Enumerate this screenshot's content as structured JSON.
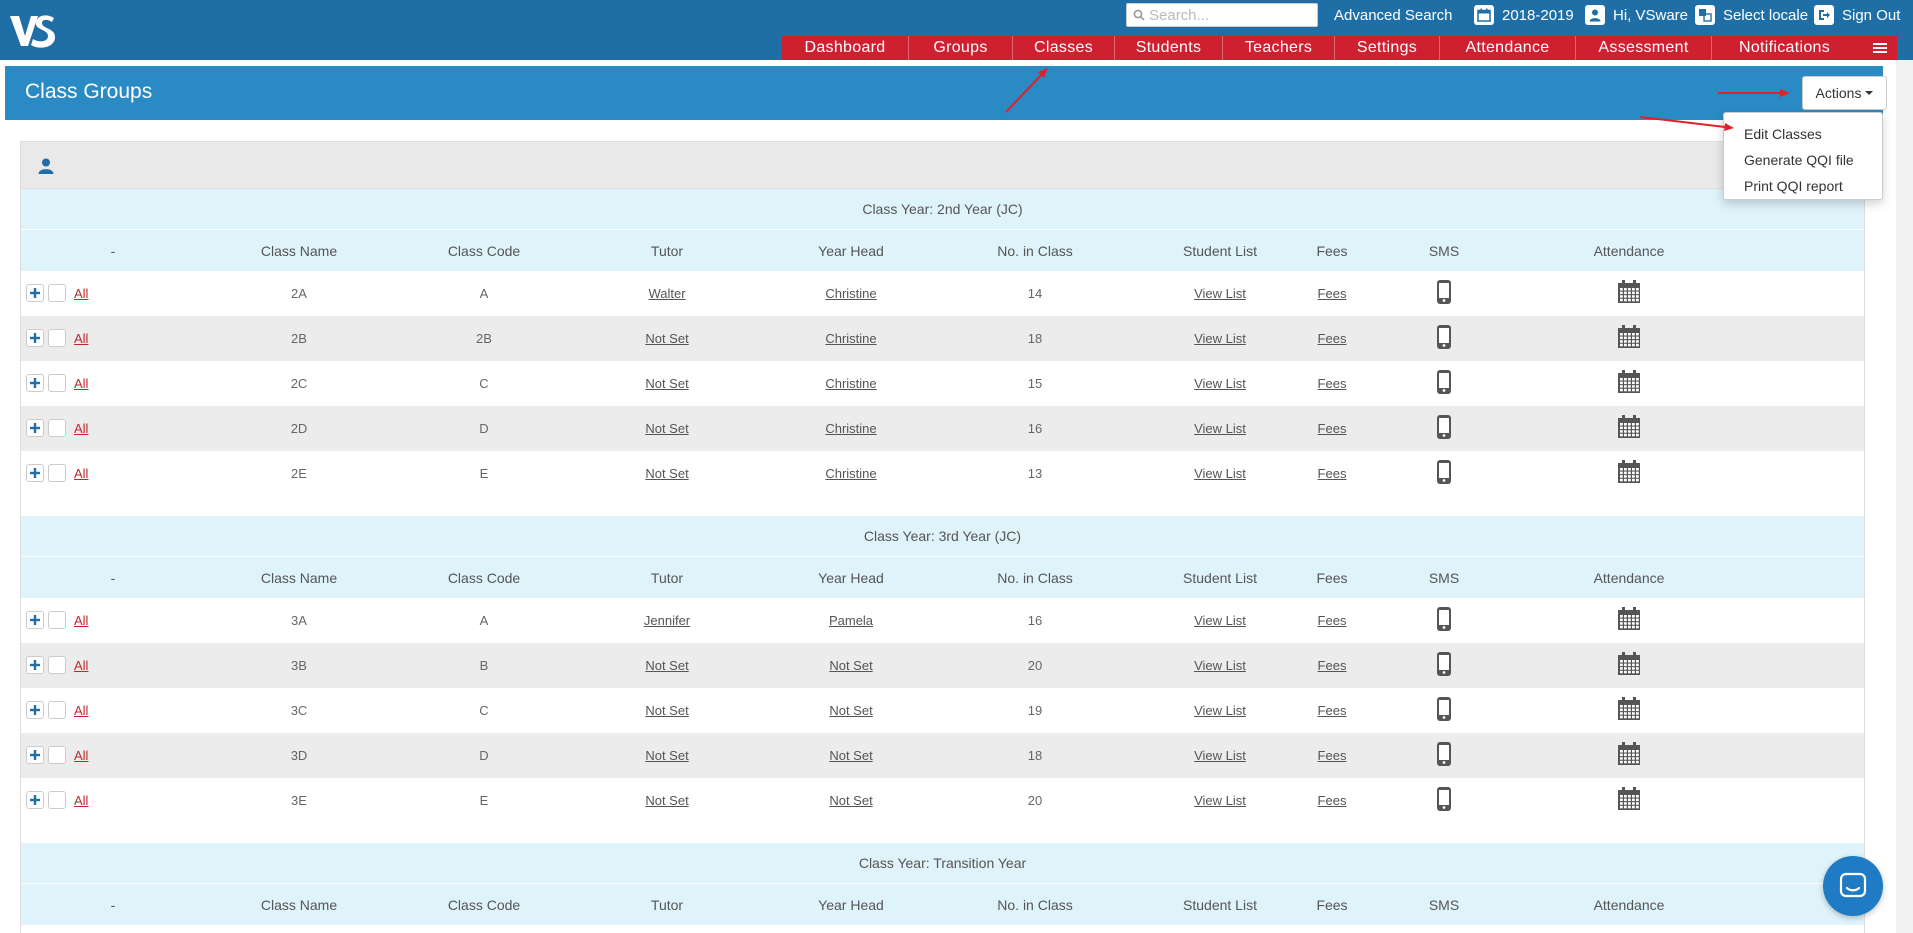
{
  "header": {
    "logo_text": "VS",
    "search_placeholder": "Search...",
    "advanced_search": "Advanced Search",
    "year": "2018-2019",
    "greeting": "Hi, VSware",
    "select_locale": "Select locale",
    "sign_out": "Sign Out"
  },
  "nav": [
    "Dashboard",
    "Groups",
    "Classes",
    "Students",
    "Teachers",
    "Settings",
    "Attendance",
    "Assessment",
    "Notifications"
  ],
  "page": {
    "title": "Class Groups",
    "actions_label": "Actions",
    "actions_menu": [
      "Edit Classes",
      "Generate QQI file",
      "Print QQI report"
    ]
  },
  "table": {
    "columns": [
      "-",
      "Class Name",
      "Class Code",
      "Tutor",
      "Year Head",
      "No. in Class",
      "Student List",
      "Fees",
      "SMS",
      "Attendance"
    ],
    "all_label": "All",
    "view_list_label": "View List",
    "fees_label": "Fees",
    "groups": [
      {
        "title": "Class Year: 2nd Year (JC)",
        "rows": [
          {
            "name": "2A",
            "code": "A",
            "tutor": "Walter",
            "year_head": "Christine",
            "count": "14"
          },
          {
            "name": "2B",
            "code": "2B",
            "tutor": "Not Set",
            "year_head": "Christine",
            "count": "18"
          },
          {
            "name": "2C",
            "code": "C",
            "tutor": "Not Set",
            "year_head": "Christine",
            "count": "15"
          },
          {
            "name": "2D",
            "code": "D",
            "tutor": "Not Set",
            "year_head": "Christine",
            "count": "16"
          },
          {
            "name": "2E",
            "code": "E",
            "tutor": "Not Set",
            "year_head": "Christine",
            "count": "13"
          }
        ]
      },
      {
        "title": "Class Year: 3rd Year (JC)",
        "rows": [
          {
            "name": "3A",
            "code": "A",
            "tutor": "Jennifer",
            "year_head": "Pamela",
            "count": "16"
          },
          {
            "name": "3B",
            "code": "B",
            "tutor": "Not Set",
            "year_head": "Not Set",
            "count": "20"
          },
          {
            "name": "3C",
            "code": "C",
            "tutor": "Not Set",
            "year_head": "Not Set",
            "count": "19"
          },
          {
            "name": "3D",
            "code": "D",
            "tutor": "Not Set",
            "year_head": "Not Set",
            "count": "18"
          },
          {
            "name": "3E",
            "code": "E",
            "tutor": "Not Set",
            "year_head": "Not Set",
            "count": "20"
          }
        ]
      },
      {
        "title": "Class Year: Transition Year",
        "rows": []
      }
    ]
  },
  "colors": {
    "header_blue": "#1f6fa6",
    "title_blue": "#2a8ac4",
    "nav_red": "#cf2030",
    "link_red": "#c1272d",
    "group_bg": "#dff3fb"
  },
  "icons": {
    "calendar": "calendar-icon",
    "user": "user-icon",
    "locale": "translate-icon",
    "sign_out": "sign-out-icon",
    "sms": "mobile-phone-icon",
    "attendance": "calendar-grid-icon",
    "chat": "chat-icon"
  }
}
